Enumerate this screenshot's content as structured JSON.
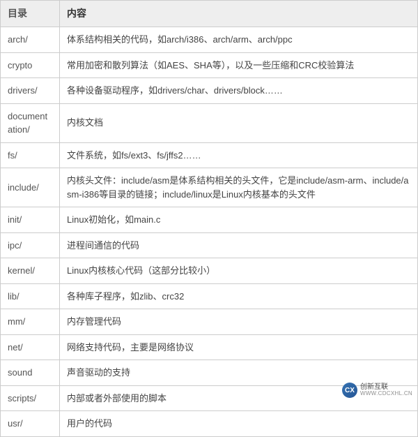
{
  "table": {
    "headers": [
      "目录",
      "内容"
    ],
    "rows": [
      {
        "dir": "arch/",
        "desc": "体系结构相关的代码，如arch/i386、arch/arm、arch/ppc"
      },
      {
        "dir": "crypto",
        "desc": "常用加密和散列算法（如AES、SHA等），以及一些压缩和CRC校验算法"
      },
      {
        "dir": "drivers/",
        "desc": "各种设备驱动程序，如drivers/char、drivers/block……"
      },
      {
        "dir": "documentation/",
        "desc": "内核文档"
      },
      {
        "dir": "fs/",
        "desc": "文件系统，如fs/ext3、fs/jffs2……"
      },
      {
        "dir": "include/",
        "desc": "内核头文件：include/asm是体系结构相关的头文件，它是include/asm-arm、include/asm-i386等目录的链接；include/linux是Linux内核基本的头文件"
      },
      {
        "dir": "init/",
        "desc": "Linux初始化，如main.c"
      },
      {
        "dir": "ipc/",
        "desc": "进程间通信的代码"
      },
      {
        "dir": "kernel/",
        "desc": "Linux内核核心代码（这部分比较小）"
      },
      {
        "dir": "lib/",
        "desc": "各种库子程序，如zlib、crc32"
      },
      {
        "dir": "mm/",
        "desc": "内存管理代码"
      },
      {
        "dir": "net/",
        "desc": "网络支持代码，主要是网络协议"
      },
      {
        "dir": "sound",
        "desc": "声音驱动的支持"
      },
      {
        "dir": "scripts/",
        "desc": "内部或者外部使用的脚本"
      },
      {
        "dir": "usr/",
        "desc": "用户的代码"
      }
    ]
  },
  "watermark": {
    "logo": "CX",
    "title": "创新互联",
    "subtitle": "WWW.CDCXHL.CN"
  }
}
